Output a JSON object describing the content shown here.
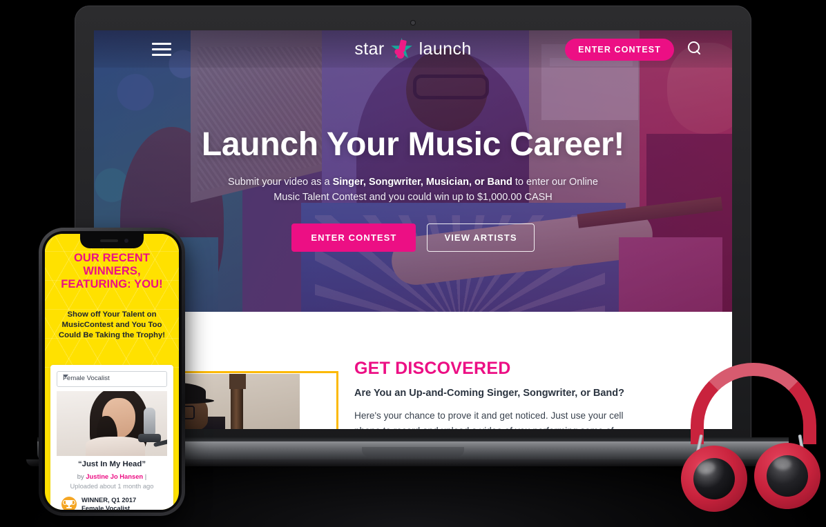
{
  "site": {
    "logo_text_left": "star",
    "logo_text_right": "launch",
    "logo_star_icon": "star-music-note-icon"
  },
  "nav": {
    "menu_icon": "hamburger-menu-icon",
    "enter_contest_label": "ENTER CONTEST",
    "search_icon": "search-icon"
  },
  "hero": {
    "heading": "Launch Your Music Career!",
    "sub_lead": "Submit your video as a ",
    "sub_bold": "Singer, Songwriter, Musician, or Band",
    "sub_tail": " to enter our Online Music Talent Contest and you could win up to $1,000.00 CASH",
    "primary_button": "ENTER CONTEST",
    "secondary_button": "VIEW ARTISTS"
  },
  "discovered": {
    "heading": "GET DISCOVERED",
    "subheading": "Are You an Up-and-Coming Singer, Songwriter, or Band?",
    "body": "Here's your chance to prove it and get noticed. Just use your cell phone to record and upload a video of you performing some of"
  },
  "phone": {
    "headline": "OUR RECENT WINNERS, FEATURING: YOU!",
    "subhead": "Show off Your Talent on MusicContest and You Too Could Be Taking the Trophy!",
    "select_value": "Female Vocalist",
    "caret_icon": "chevron-down-icon",
    "track_title": "“Just In My Head”",
    "by_prefix": "by ",
    "artist": "Justine Jo Hansen",
    "by_suffix": " |",
    "uploaded": "Uploaded about 1 month ago",
    "trophy_icon": "trophy-icon",
    "winner_line1": "WINNER, Q1 2017",
    "winner_line2": "Female Vocalist"
  },
  "devices": {
    "laptop": "laptop-device",
    "smartphone": "smartphone-device",
    "headphones": "headphones-product"
  },
  "colors": {
    "accent_pink": "#ec0f84",
    "yellow": "#ffe100",
    "teal": "#17a89a",
    "headphone_red": "#c9233d",
    "trophy_orange": "#f5a623"
  }
}
